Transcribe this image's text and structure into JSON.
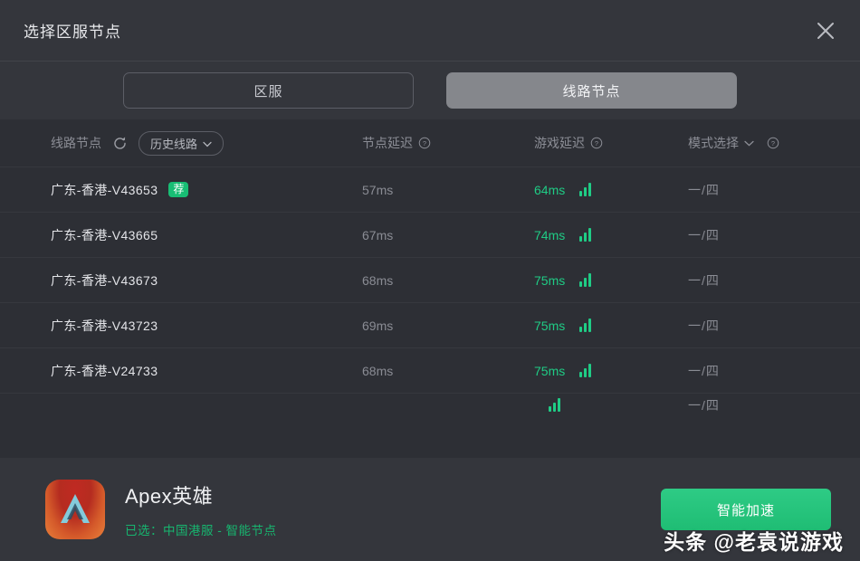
{
  "window": {
    "title": "选择区服节点",
    "close_icon": "close-icon"
  },
  "tabs": [
    {
      "label": "区服",
      "state": "inactive"
    },
    {
      "label": "线路节点",
      "state": "active"
    }
  ],
  "table": {
    "headers": {
      "node": "线路节点",
      "refresh_icon": "refresh-icon",
      "history_pill": "历史线路",
      "history_caret_icon": "chevron-down-icon",
      "node_delay": "节点延迟",
      "node_delay_help_icon": "help-icon",
      "game_delay": "游戏延迟",
      "game_delay_help_icon": "help-icon",
      "mode": "模式选择",
      "mode_caret_icon": "chevron-down-icon",
      "mode_help_icon": "help-icon"
    },
    "rows": [
      {
        "name": "广东-香港-V43653",
        "badge": "荐",
        "node_delay": "57ms",
        "game_delay": "64ms",
        "signal_icon": "signal-bars-icon",
        "mode": "一/四"
      },
      {
        "name": "广东-香港-V43665",
        "badge": "",
        "node_delay": "67ms",
        "game_delay": "74ms",
        "signal_icon": "signal-bars-icon",
        "mode": "一/四"
      },
      {
        "name": "广东-香港-V43673",
        "badge": "",
        "node_delay": "68ms",
        "game_delay": "75ms",
        "signal_icon": "signal-bars-icon",
        "mode": "一/四"
      },
      {
        "name": "广东-香港-V43723",
        "badge": "",
        "node_delay": "69ms",
        "game_delay": "75ms",
        "signal_icon": "signal-bars-icon",
        "mode": "一/四"
      },
      {
        "name": "广东-香港-V24733",
        "badge": "",
        "node_delay": "68ms",
        "game_delay": "75ms",
        "signal_icon": "signal-bars-icon",
        "mode": "一/四"
      },
      {
        "name": "",
        "badge": "",
        "node_delay": "",
        "game_delay": "",
        "signal_icon": "signal-bars-icon",
        "mode": "一/四"
      }
    ]
  },
  "footer": {
    "game_icon": "apex-legends-icon",
    "game_title": "Apex英雄",
    "selection": "已选：中国港服 - 智能节点",
    "accelerate_button": "智能加速"
  },
  "watermark": "头条 @老袁说游戏",
  "colors": {
    "dialog_bg": "#34363c",
    "table_bg": "#2d2f35",
    "accent_green": "#1fcc85",
    "badge_green": "#18bd74",
    "active_tab": "#85878c",
    "muted_text": "#8a8c94"
  }
}
